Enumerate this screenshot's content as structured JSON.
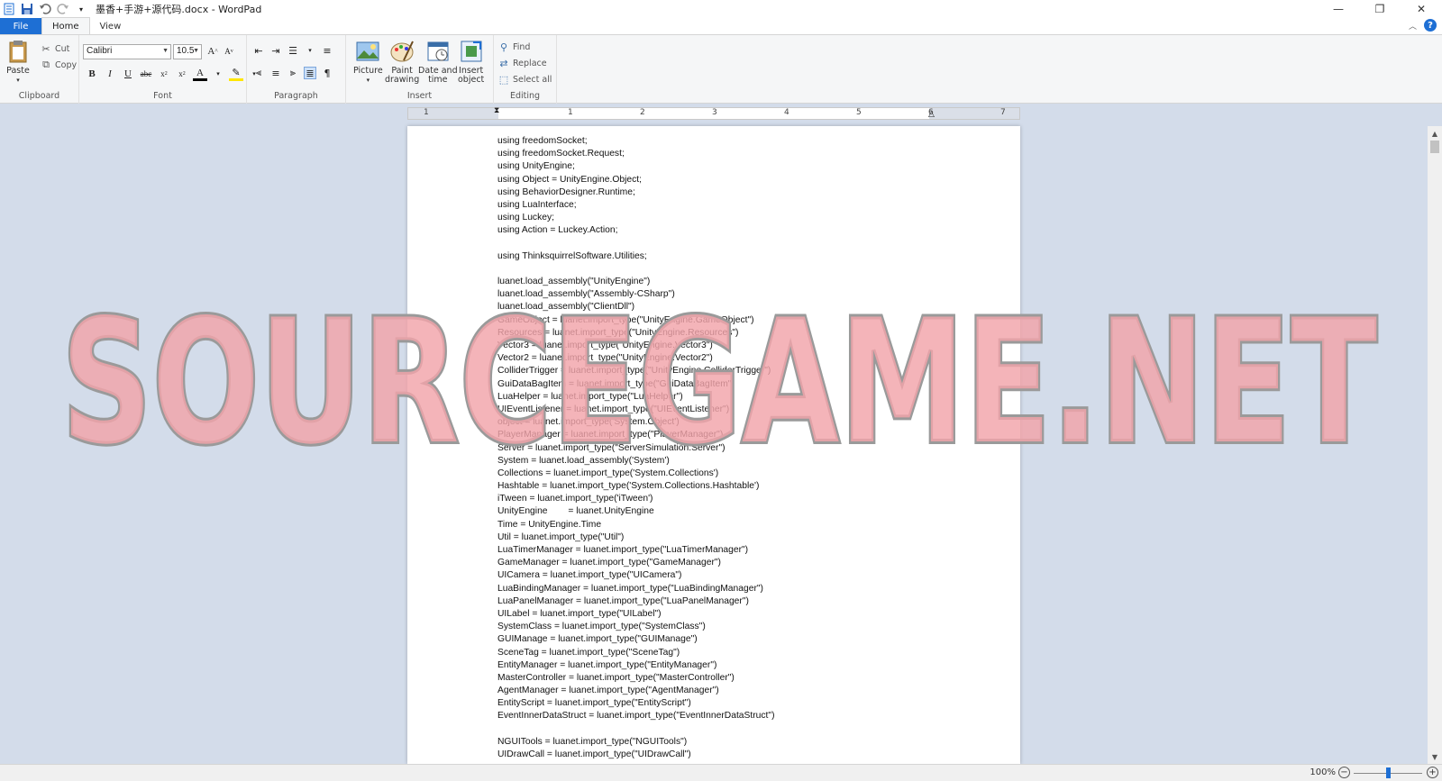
{
  "window": {
    "title": "墨香+手游+源代码.docx - WordPad",
    "minimize": "—",
    "maximize": "❐",
    "close": "✕"
  },
  "tabs": [
    {
      "label": "File"
    },
    {
      "label": "Home"
    },
    {
      "label": "View"
    }
  ],
  "ribbon": {
    "clipboard": {
      "label": "Clipboard",
      "paste": "Paste",
      "cut": "Cut",
      "copy": "Copy"
    },
    "font": {
      "label": "Font",
      "family": "Calibri",
      "size": "10.5"
    },
    "paragraph": {
      "label": "Paragraph"
    },
    "insert": {
      "label": "Insert",
      "picture": "Picture",
      "paint_drawing_1": "Paint",
      "paint_drawing_2": "drawing",
      "date_time_1": "Date and",
      "date_time_2": "time",
      "insert_object_1": "Insert",
      "insert_object_2": "object"
    },
    "editing": {
      "label": "Editing",
      "find": "Find",
      "replace": "Replace",
      "select_all": "Select all"
    }
  },
  "ruler": {
    "numbers": [
      "1",
      "1",
      "2",
      "3",
      "4",
      "5",
      "6",
      "7"
    ]
  },
  "document": {
    "lines": [
      "using freedomSocket;",
      "using freedomSocket.Request;",
      "using UnityEngine;",
      "using Object = UnityEngine.Object;",
      "using BehaviorDesigner.Runtime;",
      "using LuaInterface;",
      "using Luckey;",
      "using Action = Luckey.Action;",
      "",
      "using ThinksquirrelSoftware.Utilities;",
      "",
      "luanet.load_assembly(\"UnityEngine\")",
      "luanet.load_assembly(\"Assembly-CSharp\")",
      "luanet.load_assembly(\"ClientDll\")",
      "GameObject = luanet.import_type(\"UnityEngine.GameObject\")",
      "Resources = luanet.import_type(\"UnityEngine.Resources\")",
      "Vector3 = luanet.import_type(\"UnityEngine.Vector3\")",
      "Vector2 = luanet.import_type(\"UnityEngine.Vector2\")",
      "ColliderTrigger = luanet.import_type(\"UnityEngine.ColliderTrigger\")",
      "GuiDataBagItem = luanet.import_type(\"GuiDataBagItem\")",
      "LuaHelper = luanet.import_type(\"LuaHelper\")",
      "UIEventListener = luanet.import_type(\"UIEventListener\")",
      "object = luanet.import_type('System.Object')",
      "PlayerManager = luanet.import_type(\"PlayerManager\")",
      "Server = luanet.import_type(\"ServerSimulation.Server\")",
      "System = luanet.load_assembly('System')",
      "Collections = luanet.import_type('System.Collections')",
      "Hashtable = luanet.import_type('System.Collections.Hashtable')",
      "iTween = luanet.import_type('iTween')",
      "UnityEngine        = luanet.UnityEngine",
      "Time = UnityEngine.Time",
      "Util = luanet.import_type(\"Util\")",
      "LuaTimerManager = luanet.import_type(\"LuaTimerManager\")",
      "GameManager = luanet.import_type(\"GameManager\")",
      "UICamera = luanet.import_type(\"UICamera\")",
      "LuaBindingManager = luanet.import_type(\"LuaBindingManager\")",
      "LuaPanelManager = luanet.import_type(\"LuaPanelManager\")",
      "UILabel = luanet.import_type(\"UILabel\")",
      "SystemClass = luanet.import_type(\"SystemClass\")",
      "GUIManage = luanet.import_type(\"GUIManage\")",
      "SceneTag = luanet.import_type(\"SceneTag\")",
      "EntityManager = luanet.import_type(\"EntityManager\")",
      "MasterController = luanet.import_type(\"MasterController\")",
      "AgentManager = luanet.import_type(\"AgentManager\")",
      "EntityScript = luanet.import_type(\"EntityScript\")",
      "EventInnerDataStruct = luanet.import_type(\"EventInnerDataStruct\")",
      "",
      "NGUITools = luanet.import_type(\"NGUITools\")",
      "UIDrawCall = luanet.import_type(\"UIDrawCall\")"
    ]
  },
  "watermark": {
    "text": "SOURCEGAME.NET"
  },
  "status": {
    "zoom": "100%"
  },
  "colors": {
    "accent": "#1e6fd4",
    "watermark_fill": "#f2a3aa",
    "watermark_stroke": "#9a9a9a"
  }
}
